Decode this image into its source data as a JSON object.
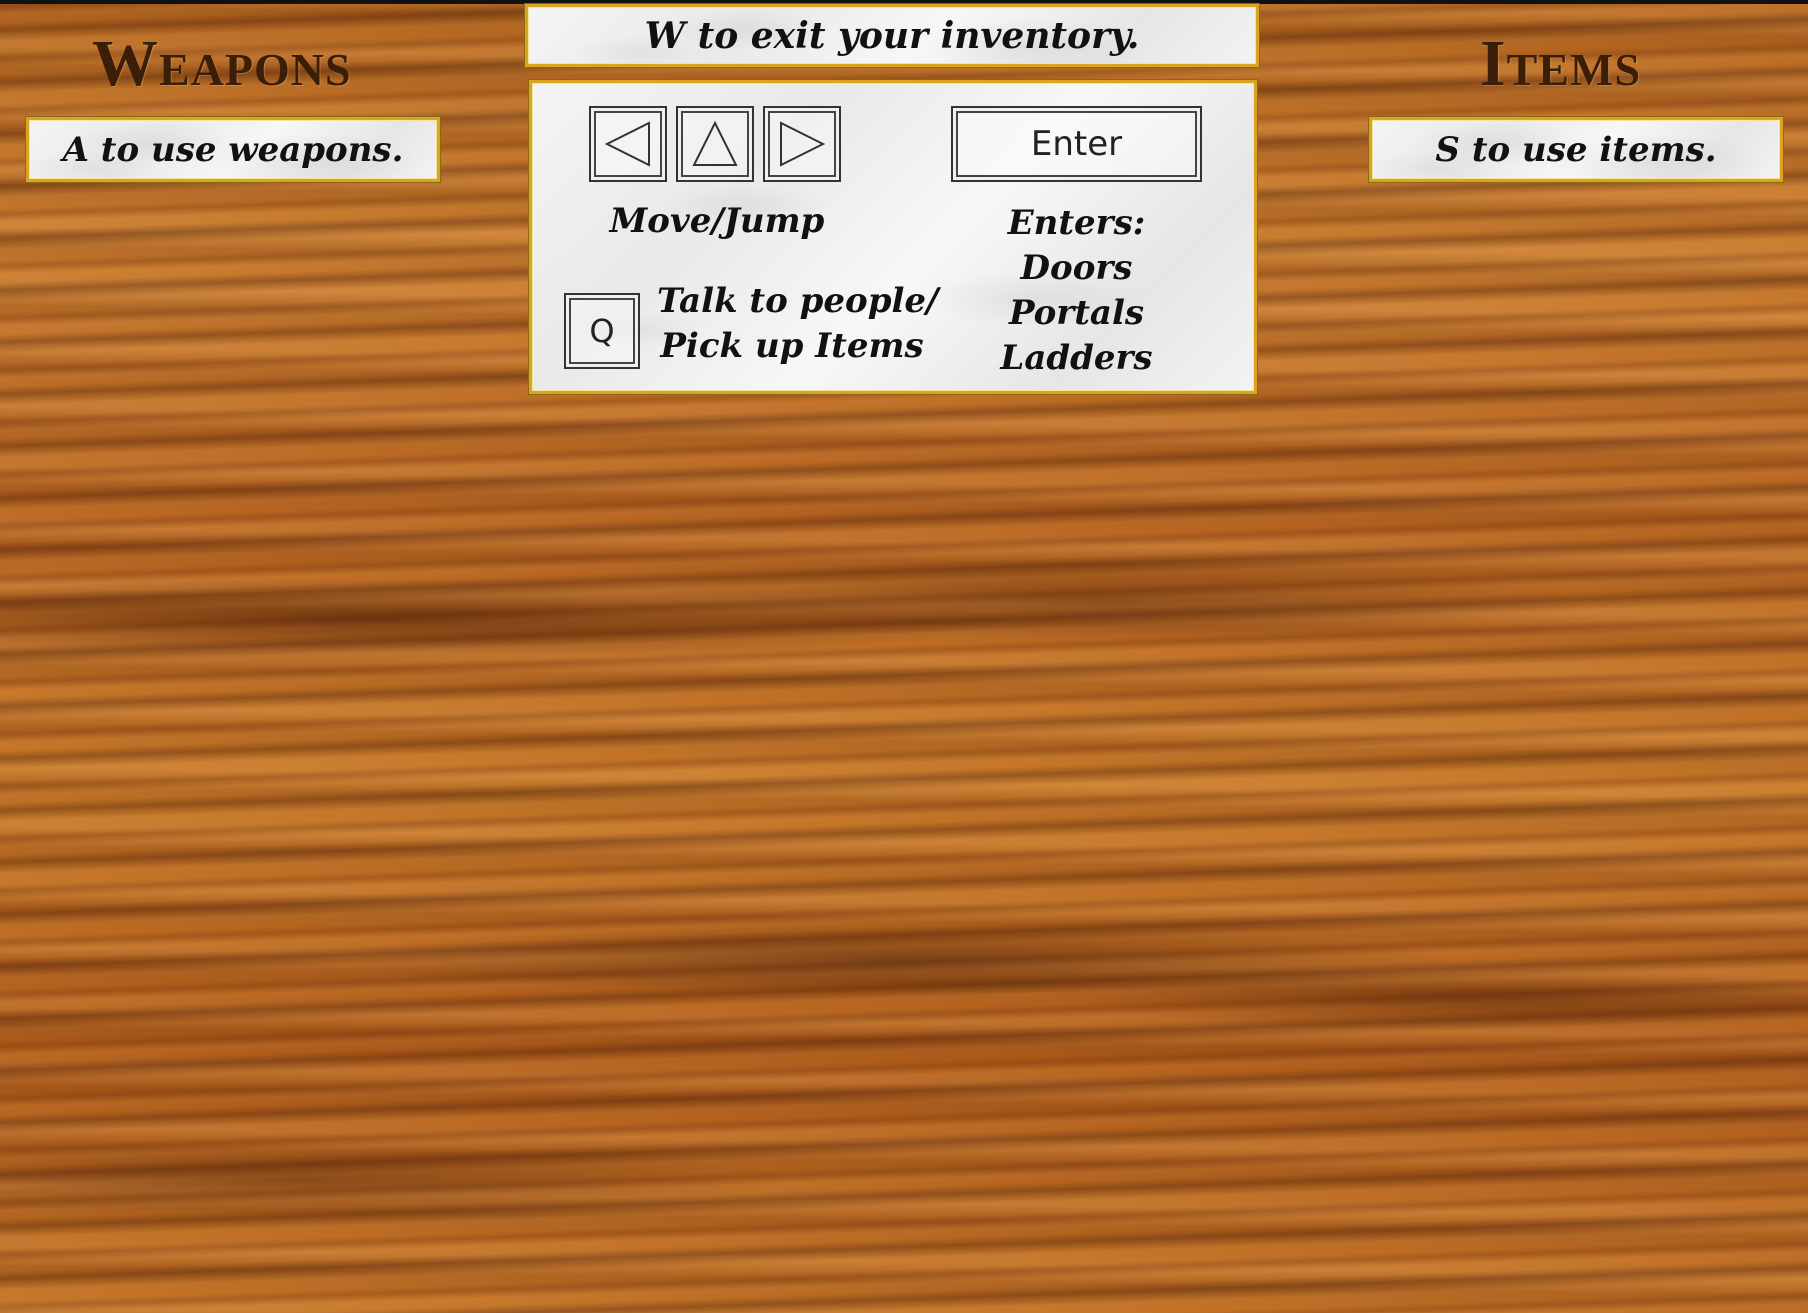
{
  "exit_banner": {
    "text": "W to exit your inventory."
  },
  "weapons": {
    "heading": "Weapons",
    "hint": "A to use weapons."
  },
  "items": {
    "heading": "Items",
    "hint": "S to use items."
  },
  "controls": {
    "move_keys": [
      "left-arrow-icon",
      "up-arrow-icon",
      "right-arrow-icon"
    ],
    "move_label": "Move/Jump",
    "enter_key": "Enter",
    "enters_title": "Enters:",
    "enters_list": [
      "Doors",
      "Portals",
      "Ladders"
    ],
    "q_key": "Q",
    "q_label_line1": "Talk to people/",
    "q_label_line2": "Pick up Items"
  },
  "colors": {
    "frame_gold": "#d9a520",
    "heading_brown": "#3a1e08",
    "wood": "#b86a22"
  }
}
